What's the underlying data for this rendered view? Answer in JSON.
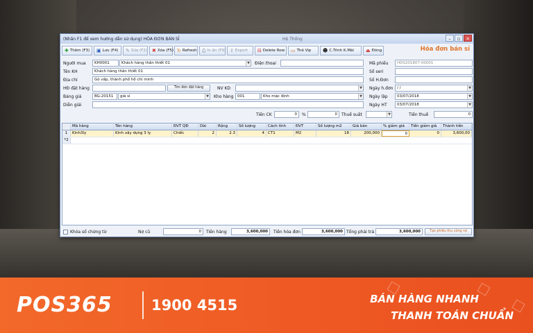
{
  "window": {
    "title": "(Nhấn F1 để xem hướng dẫn sử dụng) HÓA ĐƠN BÁN SỈ",
    "center_title": "Hệ Thống"
  },
  "toolbar": {
    "add": "Thêm (F3)",
    "save": "Lưu (F4)",
    "edit": "Sửa (F2)",
    "delete": "Xóa (F5)",
    "refresh": "Refresh",
    "print": "In ấn (F9)",
    "export": "Export",
    "delete_row": "Delete Row",
    "vip": "Thẻ Vip",
    "promo": "C.Trình K.Mãi",
    "close": "Đóng",
    "form_title": "Hóa đơn bán sỉ"
  },
  "form": {
    "customer_label": "Người mua",
    "customer_code": "KH0001",
    "customer_name_short": "Khách hàng thân thiết 01",
    "phone_label": "Điện thoại",
    "name_label": "Tên KH",
    "name_value": "Khách hàng thân thiết 01",
    "address_label": "Địa chỉ",
    "address_value": "Gò vấp, thành phố hồ chí minh",
    "order_label": "HĐ đặt hàng",
    "find_order_button": "Tìm đơn đặt hàng",
    "staff_label": "NV KD",
    "price_label": "Bảng giá",
    "price_code": "BG-20151",
    "price_name": "giá sỉ",
    "warehouse_label": "Kho hàng",
    "warehouse_code": "001",
    "warehouse_name": "Kho mặc định",
    "note_label": "Diễn giải",
    "invoice_no_label": "Mã phiếu",
    "invoice_no": "HDS201807-00001",
    "serial_label": "Số seri",
    "hd_no_label": "Số H.Đơn",
    "hd_date_label": "Ngày h.đơn",
    "hd_date": "/  /",
    "created_label": "Ngày lập",
    "created_date": "03/07/2018",
    "ht_label": "Ngày HT",
    "ht_date": "03/07/2018",
    "ck_label": "Tiền CK",
    "ck_value": "0",
    "pct_label": "%",
    "pct_value": "0",
    "vat_label": "Thuế suất",
    "tax_label": "Tiền thuế",
    "tax_value": "0"
  },
  "grid": {
    "columns": [
      "Mã hàng",
      "Tên hàng",
      "ĐVT QĐ",
      "Dài",
      "Rộng",
      "Số lượng",
      "Cách tính",
      "ĐVT",
      "Số lượng m2",
      "Giá bán",
      "% giảm giá",
      "Tiền giảm giá",
      "Thành tiền"
    ],
    "rows": [
      [
        "Kinh3ly",
        "Kính xây dựng 3 ly",
        "Chiếc",
        "2",
        "2.3",
        "4",
        "CT1",
        "M2",
        "18",
        "200,000",
        "0",
        "0",
        "3,600,00"
      ]
    ],
    "row_index": "1",
    "new_row_marker": "*2"
  },
  "footer": {
    "lock_label": "Khóa số chứng từ",
    "old_debt_label": "Nợ cũ",
    "old_debt": "0",
    "goods_label": "Tiền hàng",
    "goods": "3,600,000",
    "invoice_total_label": "Tiền hóa đơn",
    "invoice_total": "3,600,000",
    "payable_label": "Tổng phải trả",
    "payable": "3,600,000",
    "receipt_button": "Tạo phiếu thu công nợ"
  },
  "banner": {
    "logo": "POS365",
    "phone": "1900 4515",
    "slogan1": "BÁN HÀNG NHANH",
    "slogan2": "THANH TOÁN CHUẨN"
  },
  "colors": {
    "accent": "#f26a2a",
    "title_orange": "#e0742a",
    "selected_row": "#fff3cc"
  }
}
